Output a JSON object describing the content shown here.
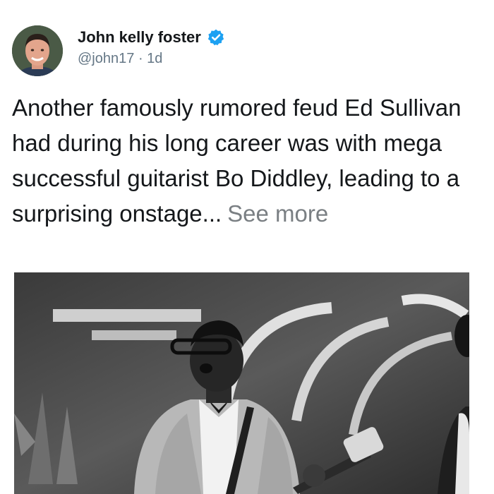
{
  "author": {
    "display_name": "John kelly foster",
    "handle": "@john17",
    "separator": "·",
    "time_ago": "1d",
    "verified": true
  },
  "tweet": {
    "text": "Another famously rumored feud Ed Sullivan had during his long career was with mega successful guitarist Bo Diddley, leading to a surprising onstage...",
    "see_more_label": "See more"
  },
  "icons": {
    "verified": "verified-badge-icon",
    "avatar": "profile-photo"
  },
  "colors": {
    "verified_blue": "#1da1f2",
    "text_primary": "#14171a",
    "text_secondary": "#657786",
    "see_more": "#7a7f83"
  }
}
